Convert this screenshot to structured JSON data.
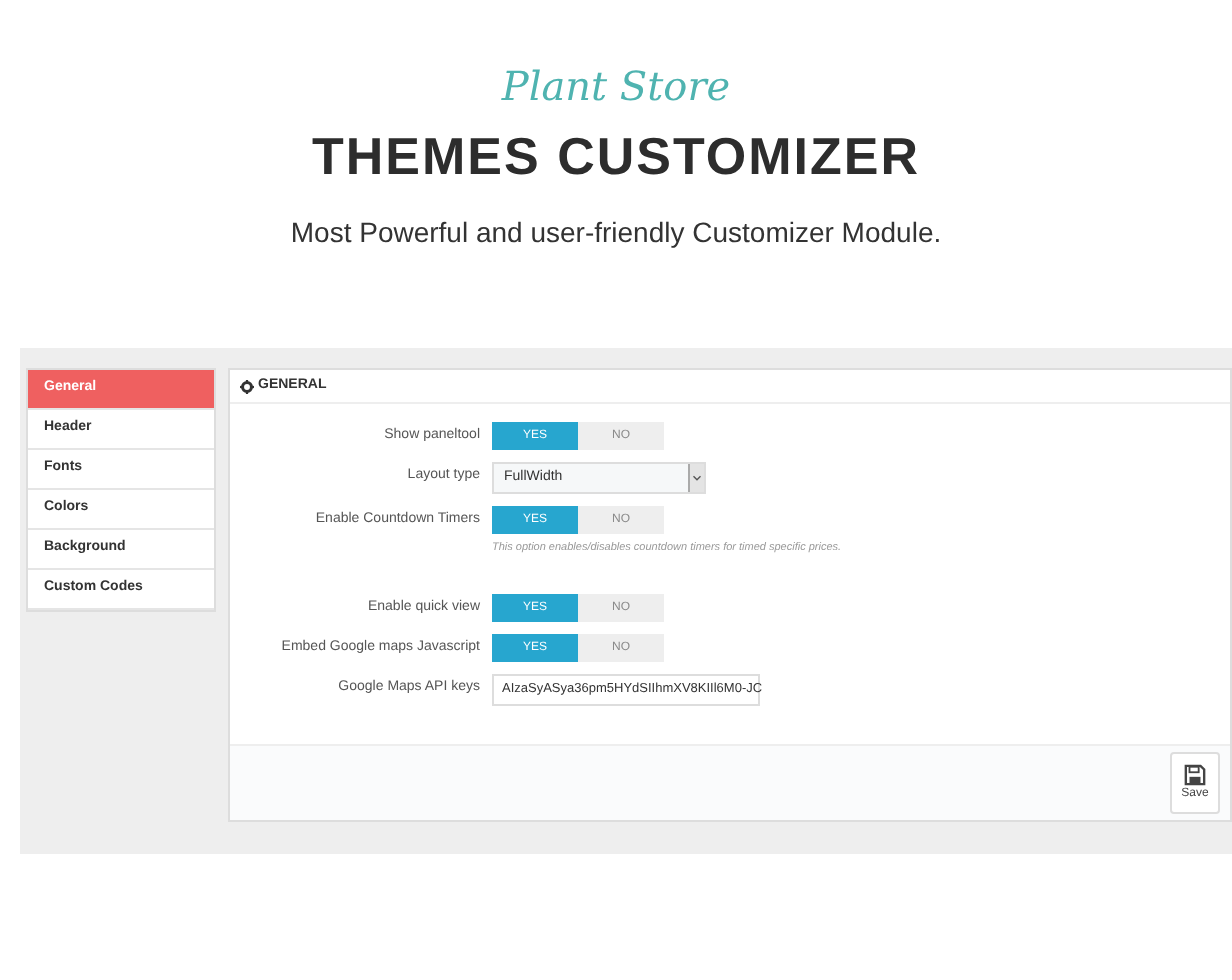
{
  "header": {
    "brand": "Plant Store",
    "title": "THEMES CUSTOMIZER",
    "subtitle": "Most Powerful and user-friendly Customizer Module."
  },
  "sidebar": {
    "items": [
      {
        "label": "General",
        "selected": true
      },
      {
        "label": "Header",
        "selected": false
      },
      {
        "label": "Fonts",
        "selected": false
      },
      {
        "label": "Colors",
        "selected": false
      },
      {
        "label": "Background",
        "selected": false
      },
      {
        "label": "Custom Codes",
        "selected": false
      }
    ]
  },
  "panel": {
    "title": "GENERAL",
    "settings": [
      {
        "kind": "toggle",
        "label": "Show paneltool",
        "options": [
          {
            "label": "YES",
            "selected": true
          },
          {
            "label": "NO",
            "selected": false
          }
        ]
      },
      {
        "kind": "select",
        "label": "Layout type",
        "value": "FullWidth"
      },
      {
        "kind": "toggle",
        "label": "Enable Countdown Timers",
        "options": [
          {
            "label": "YES",
            "selected": true
          },
          {
            "label": "NO",
            "selected": false
          }
        ],
        "help": "This option enables/disables countdown timers for timed specific prices."
      },
      {
        "kind": "toggle",
        "label": "Enable quick view",
        "options": [
          {
            "label": "YES",
            "selected": true
          },
          {
            "label": "NO",
            "selected": false
          }
        ]
      },
      {
        "kind": "toggle",
        "label": "Embed Google maps Javascript",
        "options": [
          {
            "label": "YES",
            "selected": true
          },
          {
            "label": "NO",
            "selected": false
          }
        ]
      },
      {
        "kind": "text",
        "label": "Google Maps API keys",
        "value": "AIzaSyASya36pm5HYdSIIhmXV8KIIl6M0-JC"
      }
    ],
    "save_button": "Save"
  }
}
